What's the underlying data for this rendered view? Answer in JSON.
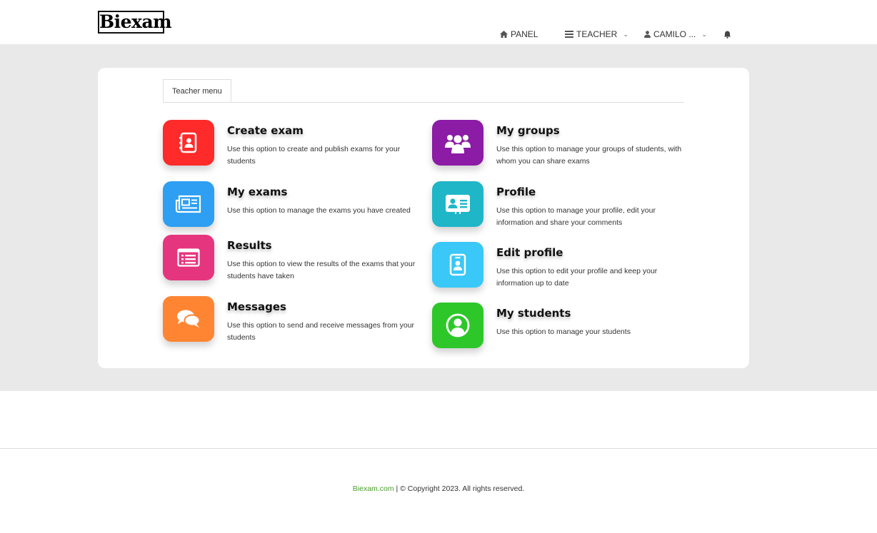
{
  "brand": {
    "logo_text": "Biexam"
  },
  "nav": {
    "panel": {
      "label": "PANEL",
      "icon": "home-icon"
    },
    "teacher": {
      "label": "TEACHER",
      "icon": "list-icon"
    },
    "user": {
      "label": "CAMILO ...",
      "icon": "user-icon"
    },
    "notifications": {
      "icon": "bell-icon"
    }
  },
  "tabs": [
    {
      "label": "Teacher menu",
      "active": true
    }
  ],
  "menu_left": [
    {
      "title": "Create exam",
      "description": "Use this option to create and publish exams for your students",
      "color": "#ff2a2a",
      "icon": "address-book-icon"
    },
    {
      "title": "My exams",
      "description": "Use this option to manage the exams you have created",
      "color": "#2e9ff2",
      "icon": "newspaper-icon"
    },
    {
      "title": "Results",
      "description": "Use this option to view the results of the exams that your students have taken",
      "color": "#e6357f",
      "icon": "list-alt-icon"
    },
    {
      "title": "Messages",
      "description": "Use this option to send and receive messages from your students",
      "color": "#ff8533",
      "icon": "comments-icon"
    }
  ],
  "menu_right": [
    {
      "title": "My groups",
      "description": "Use this option to manage your groups of students, with whom you can share exams",
      "color": "#8c1ba6",
      "icon": "users-icon"
    },
    {
      "title": "Profile",
      "description": "Use this option to manage your profile, edit your information and share your comments",
      "color": "#1fb6c8",
      "icon": "id-card-icon"
    },
    {
      "title": "Edit profile",
      "description": "Use this option to edit your profile and keep your information up to date",
      "color": "#39c8f7",
      "icon": "id-badge-icon"
    },
    {
      "title": "My students",
      "description": "Use this option to manage your students",
      "color": "#2ec72a",
      "icon": "user-circle-icon"
    }
  ],
  "footer": {
    "site": "Biexam.com",
    "copyright": "| © Copyright  2023.  All rights reserved."
  }
}
